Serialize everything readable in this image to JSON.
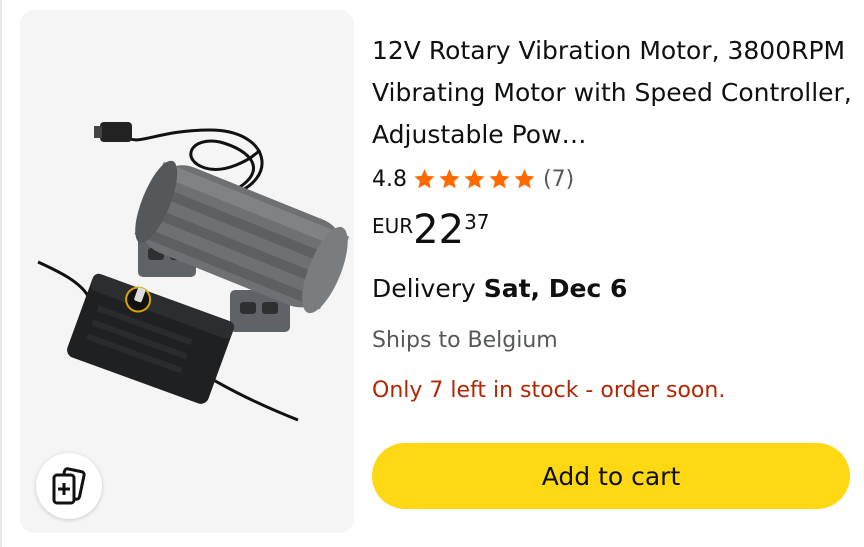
{
  "product": {
    "title": "12V Rotary Vibration Motor, 3800RPM Vibrating Motor with Speed Controller, Adjustable Pow…",
    "image_alt": "12V rotary vibration motor with speed controller",
    "rating": "4.8",
    "rating_fraction": 0.96,
    "review_count": "(7)",
    "price": {
      "currency": "EUR",
      "whole": "22",
      "fraction": "37"
    },
    "delivery": {
      "label": "Delivery",
      "date": "Sat, Dec 6"
    },
    "ships_to": "Ships to Belgium",
    "stock_notice": "Only 7 left in stock - order soon."
  },
  "actions": {
    "add_to_cart": "Add to cart",
    "compare_icon": "compare-cards-icon"
  },
  "colors": {
    "star": "#ff6900",
    "stock_red": "#b12704",
    "button_yellow": "#ffd814",
    "muted_text": "#565959"
  }
}
